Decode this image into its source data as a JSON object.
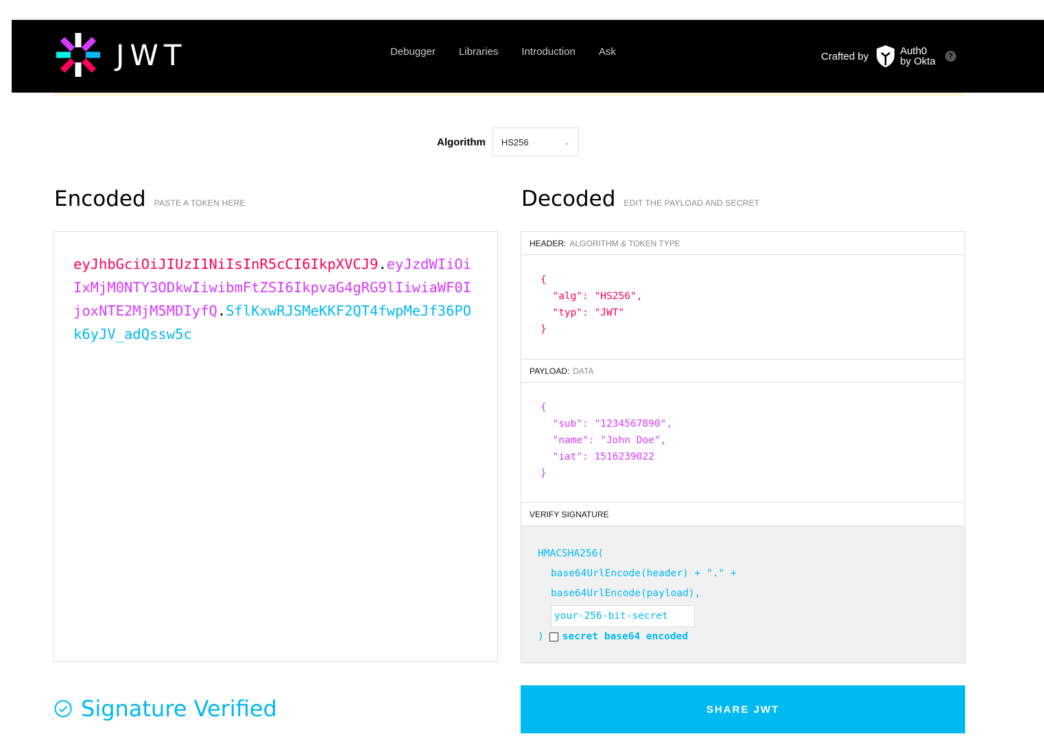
{
  "nav": {
    "logo_text": "JWT",
    "links": [
      "Debugger",
      "Libraries",
      "Introduction",
      "Ask"
    ],
    "crafted_by": "Crafted by",
    "brand_line1": "Auth0",
    "brand_line2": "by Okta",
    "help": "?"
  },
  "algorithm": {
    "label": "Algorithm",
    "selected": "HS256"
  },
  "encoded": {
    "title": "Encoded",
    "subtitle": "PASTE A TOKEN HERE",
    "header_part": "eyJhbGciOiJIUzI1NiIsInR5cCI6IkpXVCJ9",
    "payload_part": "eyJzdWIiOiIxMjM0NTY3ODkwIiwibmFtZSI6IkpvaG4gRG9lIiwiaWF0IjoxNTE2MjM5MDIyfQ",
    "signature_part": "SflKxwRJSMeKKF2QT4fwpMeJf36POk6yJV_adQssw5c",
    "dot": "."
  },
  "decoded": {
    "title": "Decoded",
    "subtitle": "EDIT THE PAYLOAD AND SECRET",
    "header_label": "HEADER:",
    "header_sub": "ALGORITHM & TOKEN TYPE",
    "header_json": "{\n  \"alg\": \"HS256\",\n  \"typ\": \"JWT\"\n}",
    "payload_label": "PAYLOAD:",
    "payload_sub": "DATA",
    "payload_json": "{\n  \"sub\": \"1234567890\",\n  \"name\": \"John Doe\",\n  \"iat\": 1516239022\n}",
    "verify_label": "VERIFY SIGNATURE",
    "sig_fn": "HMACSHA256(",
    "sig_line1": "base64UrlEncode(header) + \".\" +",
    "sig_line2": "base64UrlEncode(payload),",
    "secret_placeholder": "your-256-bit-secret",
    "close_paren": ")",
    "base64_label": "secret base64 encoded"
  },
  "status": {
    "verified": "Signature Verified"
  },
  "share_button": "SHARE JWT",
  "colors": {
    "header": "#fb015b",
    "payload": "#d63aff",
    "signature": "#00b9f1"
  }
}
